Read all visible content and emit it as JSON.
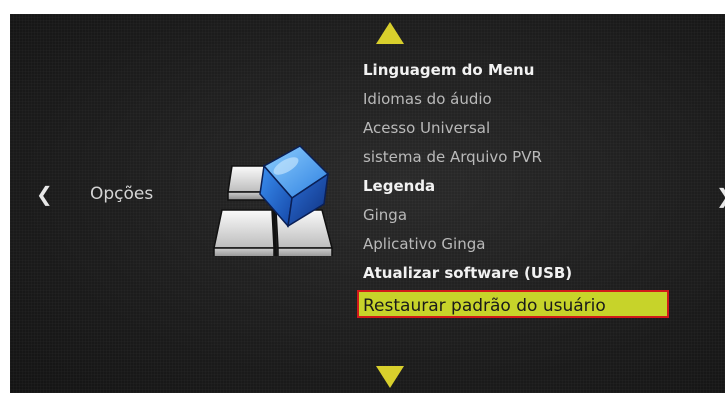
{
  "screen": {
    "section_label": "Opções",
    "icons": {
      "nav_left": "chevron-left-icon",
      "nav_right": "chevron-right-icon",
      "scroll_up": "triangle-up-icon",
      "scroll_down": "triangle-down-icon",
      "section": "options-cube-icon"
    },
    "colors": {
      "background": "#1c1c1c",
      "arrow": "#d8cf2c",
      "selected_bg": "#c7d32a",
      "selected_border": "#d11a1a",
      "text_dim": "#b9b9b9",
      "text_bright": "#f2f2f2"
    }
  },
  "menu": {
    "items": [
      {
        "label": "Linguagem do Menu"
      },
      {
        "label": "Idiomas do áudio"
      },
      {
        "label": "Acesso Universal"
      },
      {
        "label": "sistema de Arquivo PVR"
      },
      {
        "label": "Legenda"
      },
      {
        "label": "Ginga"
      },
      {
        "label": "Aplicativo Ginga"
      },
      {
        "label": "Atualizar software (USB)"
      },
      {
        "label": "Restaurar padrão do usuário"
      }
    ]
  }
}
